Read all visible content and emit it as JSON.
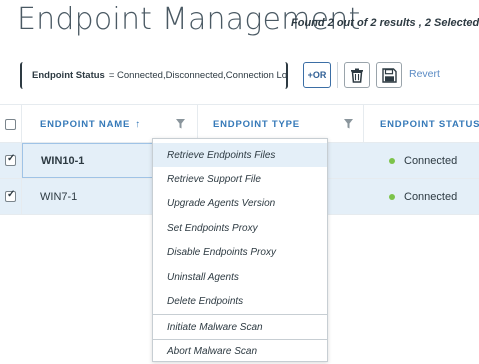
{
  "header": {
    "title": "Endpoint Management",
    "results": "Found 2 out of 2 results , 2 Selected"
  },
  "filter": {
    "key": "Endpoint Status",
    "value": "= Connected,Disconnected,Connection Lost"
  },
  "toolbar": {
    "or_label": "+OR",
    "trash_icon": "trash-icon",
    "save_icon": "floppy-disk-icon",
    "revert_label": "Revert"
  },
  "table": {
    "columns": [
      "ENDPOINT NAME",
      "ENDPOINT TYPE",
      "ENDPOINT STATUS"
    ],
    "sort_icon": "sort-ascending-icon",
    "rows": [
      {
        "name": "WIN10-1",
        "status": "Connected",
        "checked": true
      },
      {
        "name": "WIN7-1",
        "status": "Connected",
        "checked": true
      }
    ]
  },
  "context_menu": {
    "items": [
      "Retrieve Endpoints Files",
      "Retrieve Support File",
      "Upgrade Agents Version",
      "Set Endpoints Proxy",
      "Disable Endpoints Proxy",
      "Uninstall Agents",
      "Delete Endpoints",
      "Initiate Malware Scan",
      "Abort Malware Scan"
    ]
  },
  "colors": {
    "accent": "#3579b8",
    "status_connected": "#7cc34a",
    "selected_row": "#e4eff8"
  }
}
